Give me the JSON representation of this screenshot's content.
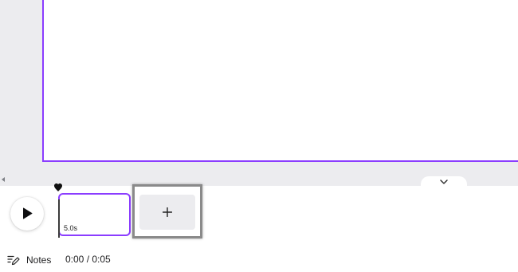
{
  "canvas": {
    "page_border_color": "#8b3dff",
    "background_color": "#ececef"
  },
  "timeline": {
    "play_icon": "play-icon",
    "pages": [
      {
        "duration": "5.0s",
        "selected": true
      }
    ],
    "add_page_icon": "plus-icon",
    "collapse_icon": "chevron-down-icon"
  },
  "footer": {
    "notes_icon": "notes-pencil-icon",
    "notes_label": "Notes",
    "time": "0:00 / 0:05"
  }
}
